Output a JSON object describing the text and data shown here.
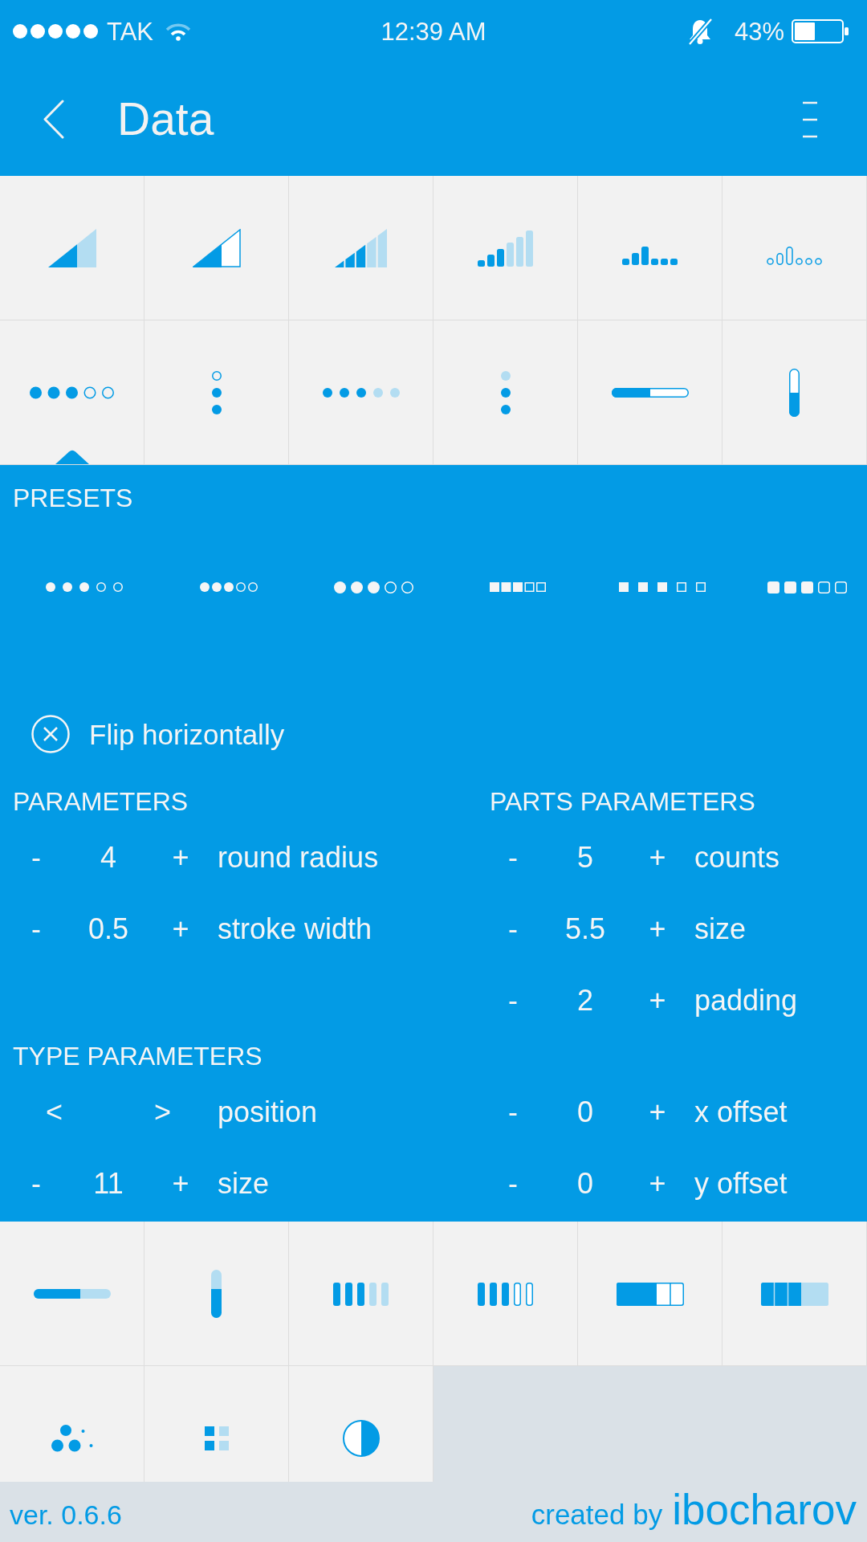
{
  "status_bar": {
    "carrier": "TAK",
    "time": "12:39 AM",
    "battery": "43%"
  },
  "app_bar": {
    "title": "Data"
  },
  "top_grid": {
    "tiles": [
      {
        "kind": "wedge",
        "selected": false
      },
      {
        "kind": "wedgeoutline",
        "selected": false
      },
      {
        "kind": "steps",
        "selected": false
      },
      {
        "kind": "bars",
        "selected": false
      },
      {
        "kind": "peak",
        "selected": false
      },
      {
        "kind": "peakoutline",
        "selected": false
      },
      {
        "kind": "dots",
        "selected": true
      },
      {
        "kind": "vdots",
        "selected": false
      },
      {
        "kind": "fadedots",
        "selected": false
      },
      {
        "kind": "fadevdots",
        "selected": false
      },
      {
        "kind": "hbar",
        "selected": false
      },
      {
        "kind": "vbar",
        "selected": false
      }
    ]
  },
  "presets": {
    "title": "PRESETS",
    "items": [
      {
        "kind": "dots"
      },
      {
        "kind": "beads"
      },
      {
        "kind": "discs"
      },
      {
        "kind": "blocks"
      },
      {
        "kind": "squares"
      },
      {
        "kind": "tiles"
      }
    ]
  },
  "flip": {
    "label": "Flip horizontally",
    "checked": false
  },
  "parameters": {
    "title": "PARAMETERS",
    "rows": [
      {
        "kind": "stepper",
        "minus": "-",
        "value": "4",
        "plus": "+",
        "label": "round radius"
      },
      {
        "kind": "stepper",
        "minus": "-",
        "value": "0.5",
        "plus": "+",
        "label": "stroke width"
      }
    ]
  },
  "type_parameters": {
    "title": "TYPE PARAMETERS",
    "rows": [
      {
        "kind": "switcher",
        "prev": "<",
        "next": ">",
        "label": "position"
      },
      {
        "kind": "stepper",
        "minus": "-",
        "value": "11",
        "plus": "+",
        "label": "size"
      }
    ]
  },
  "parts_parameters": {
    "title": "PARTS PARAMETERS",
    "rows": [
      {
        "kind": "stepper",
        "minus": "-",
        "value": "5",
        "plus": "+",
        "label": "counts"
      },
      {
        "kind": "stepper",
        "minus": "-",
        "value": "5.5",
        "plus": "+",
        "label": "size"
      },
      {
        "kind": "stepper",
        "minus": "-",
        "value": "2",
        "plus": "+",
        "label": "padding"
      },
      {
        "kind": "stepper",
        "minus": "-",
        "value": "0",
        "plus": "+",
        "label": "x offset"
      },
      {
        "kind": "stepper",
        "minus": "-",
        "value": "0",
        "plus": "+",
        "label": "y offset"
      }
    ]
  },
  "bottom_grid": {
    "tiles": [
      {
        "kind": "line",
        "selected": false
      },
      {
        "kind": "column",
        "selected": false
      },
      {
        "kind": "segments",
        "selected": false
      },
      {
        "kind": "segmentsoutline",
        "selected": false
      },
      {
        "kind": "blocksoutline",
        "selected": false
      },
      {
        "kind": "blocks",
        "selected": false
      },
      {
        "kind": "cluster",
        "selected": false
      },
      {
        "kind": "quad",
        "selected": false
      },
      {
        "kind": "halfcircle",
        "selected": false
      }
    ]
  },
  "footer": {
    "version": "ver. 0.6.6",
    "credit": "created by",
    "author": "ibocharov"
  }
}
